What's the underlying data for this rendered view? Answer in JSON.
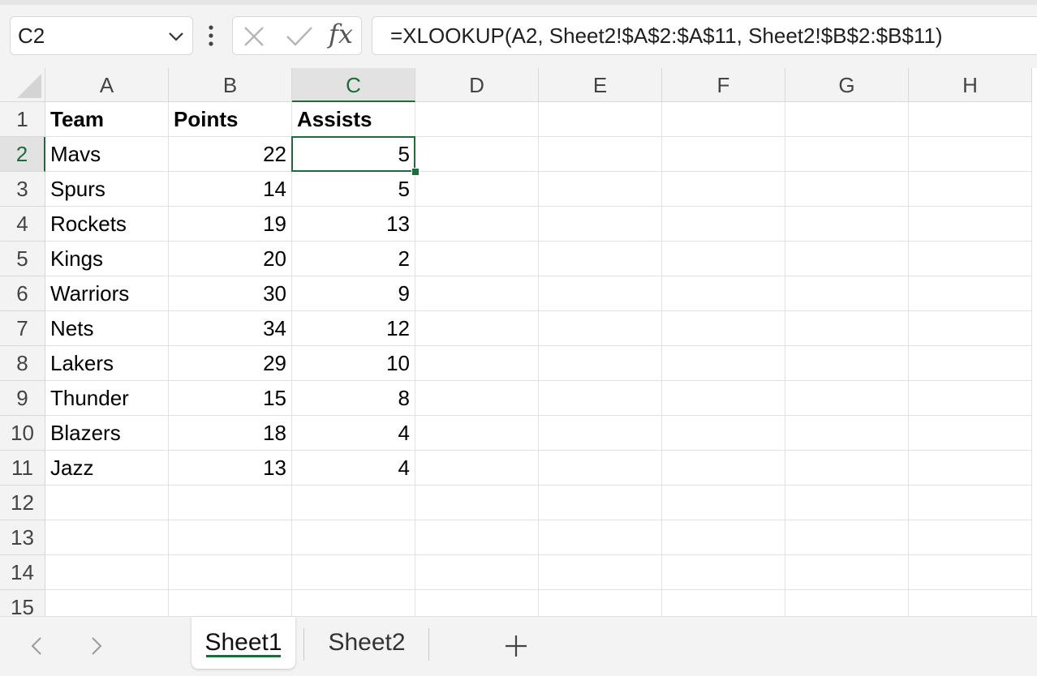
{
  "name_box": {
    "value": "C2"
  },
  "formula_bar": {
    "formula": "=XLOOKUP(A2, Sheet2!$A$2:$A$11, Sheet2!$B$2:$B$11)",
    "fx_label": "fx"
  },
  "colors": {
    "accent": "#1e6b3c",
    "header_bg": "#f3f3f3",
    "grid_line": "#e1e1e1"
  },
  "columns": [
    "A",
    "B",
    "C",
    "D",
    "E",
    "F",
    "G",
    "H"
  ],
  "rows": [
    "1",
    "2",
    "3",
    "4",
    "5",
    "6",
    "7",
    "8",
    "9",
    "10",
    "11",
    "12",
    "13",
    "14",
    "15"
  ],
  "selected": {
    "column": "C",
    "row": "2"
  },
  "sheet": {
    "headers": [
      "Team",
      "Points",
      "Assists"
    ],
    "data": [
      [
        "Mavs",
        "22",
        "5"
      ],
      [
        "Spurs",
        "14",
        "5"
      ],
      [
        "Rockets",
        "19",
        "13"
      ],
      [
        "Kings",
        "20",
        "2"
      ],
      [
        "Warriors",
        "30",
        "9"
      ],
      [
        "Nets",
        "34",
        "12"
      ],
      [
        "Lakers",
        "29",
        "10"
      ],
      [
        "Thunder",
        "15",
        "8"
      ],
      [
        "Blazers",
        "18",
        "4"
      ],
      [
        "Jazz",
        "13",
        "4"
      ]
    ]
  },
  "tabs": [
    {
      "label": "Sheet1",
      "active": true
    },
    {
      "label": "Sheet2",
      "active": false
    }
  ],
  "icons": {
    "name_box_dropdown": "chevron-down-icon",
    "more": "kebab-icon",
    "cancel": "close-icon",
    "enter": "checkmark-icon",
    "prev_sheet": "chevron-left-icon",
    "next_sheet": "chevron-right-icon",
    "add_sheet": "plus-icon"
  }
}
